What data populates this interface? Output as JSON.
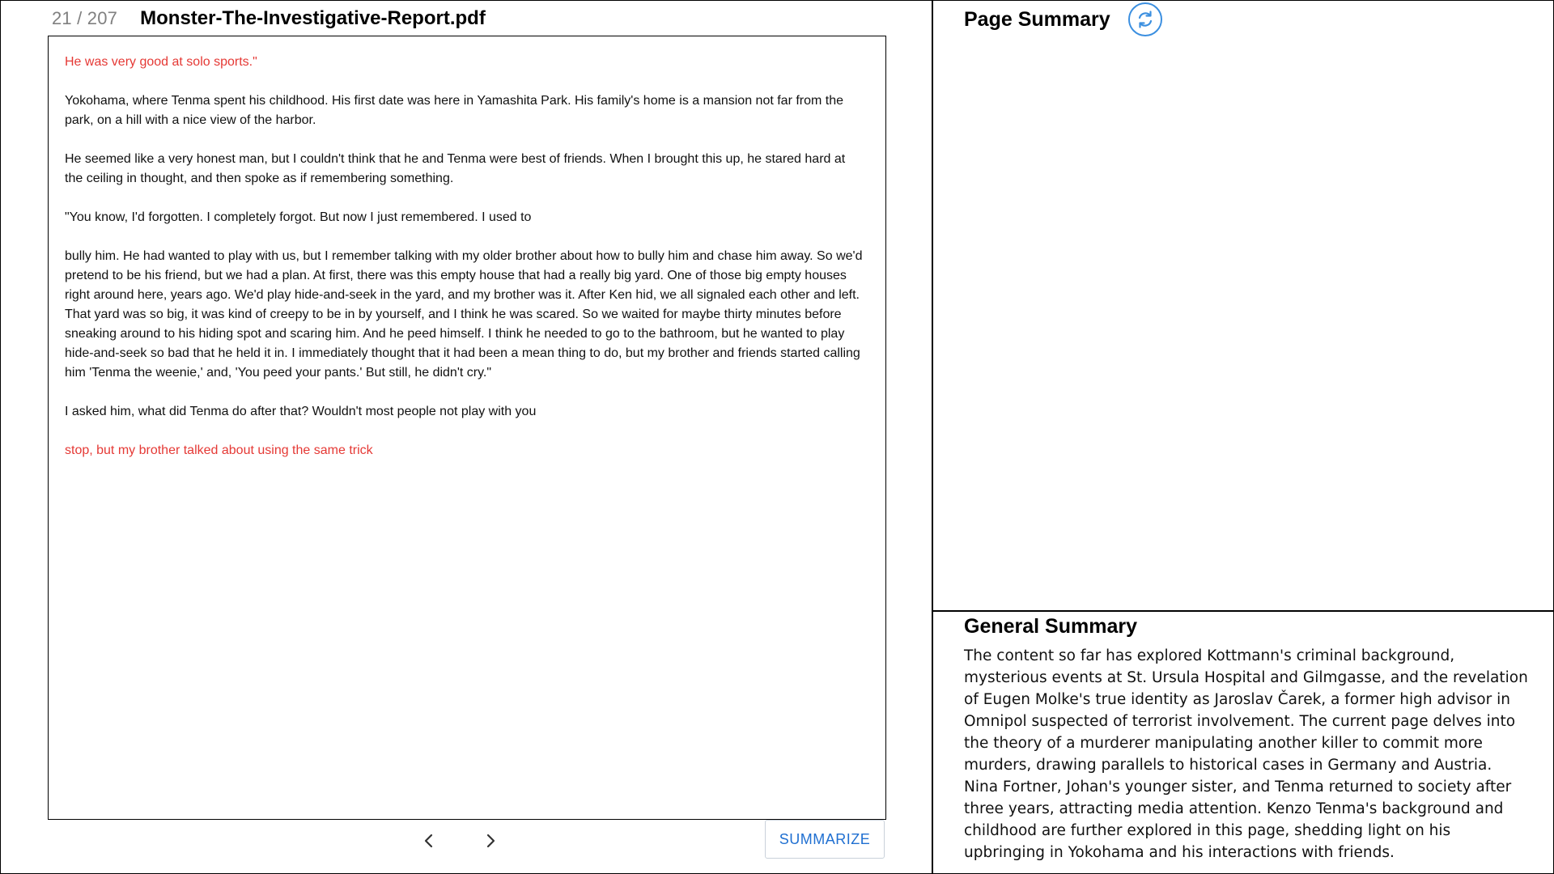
{
  "document": {
    "page_indicator": "21 / 207",
    "title": "Monster-The-Investigative-Report.pdf",
    "paragraphs": [
      {
        "text": "He was very good at solo sports.\"",
        "highlight": true
      },
      {
        "text": "Yokohama, where Tenma spent his childhood. His first date was here in Yamashita Park. His family's home is a mansion not far from the park, on a hill with a nice view of the harbor.",
        "highlight": false
      },
      {
        "text": "He seemed like a very honest man, but I couldn't think that he and Tenma were best of friends. When I brought this up, he stared hard at the ceiling in thought, and then spoke as if remembering something.",
        "highlight": false
      },
      {
        "text": "\"You know, I'd forgotten. I completely forgot. But now I just remembered. I used to",
        "highlight": false
      },
      {
        "text": "bully him. He had wanted to play with us, but I remember talking with my older brother about how to bully him and chase him away. So we'd pretend to be his friend, but we had a plan. At first, there was this empty house that had a really big yard. One of those big empty houses right around here, years ago. We'd play hide-and-seek in the yard, and my brother was it. After Ken hid, we all signaled each other and left. That yard was so big, it was kind of creepy to be in by yourself, and I think he was scared. So we waited for maybe thirty minutes before sneaking around to his hiding spot and scaring him. And he peed himself. I think he needed to go to the bathroom, but he wanted to play hide-and-seek so bad that he held it in. I immediately thought that it had been a mean thing to do, but my brother and friends started calling him 'Tenma the weenie,' and, 'You peed your pants.' But still, he didn't cry.\"",
        "highlight": false
      },
      {
        "text": "I asked him, what did Tenma do after that? Wouldn't most people not play with you",
        "highlight": false
      },
      {
        "text": "stop, but my brother talked about using the same trick",
        "highlight": true
      }
    ]
  },
  "navigation": {
    "prev_icon": "chevron-left-icon",
    "next_icon": "chevron-right-icon"
  },
  "summarize_button": "SUMMARIZE",
  "page_summary": {
    "title": "Page Summary",
    "refresh_icon": "refresh-icon",
    "text": ""
  },
  "general_summary": {
    "title": "General Summary",
    "text": "The content so far has explored Kottmann's criminal background, mysterious events at St. Ursula Hospital and Gilmgasse, and the revelation of Eugen Molke's true identity as Jaroslav Čarek, a former high advisor in Omnipol suspected of terrorist involvement. The current page delves into the theory of a murderer manipulating another killer to commit more murders, drawing parallels to historical cases in Germany and Austria. Nina Fortner, Johan's younger sister, and Tenma returned to society after three years, attracting media attention. Kenzo Tenma's background and childhood are further explored in this page, shedding light on his upbringing in Yokohama and his interactions with friends."
  },
  "colors": {
    "highlight_text": "#e53935",
    "accent_blue": "#1f6fd1",
    "refresh_ring": "#3b8fe0",
    "page_count_gray": "#808080"
  }
}
